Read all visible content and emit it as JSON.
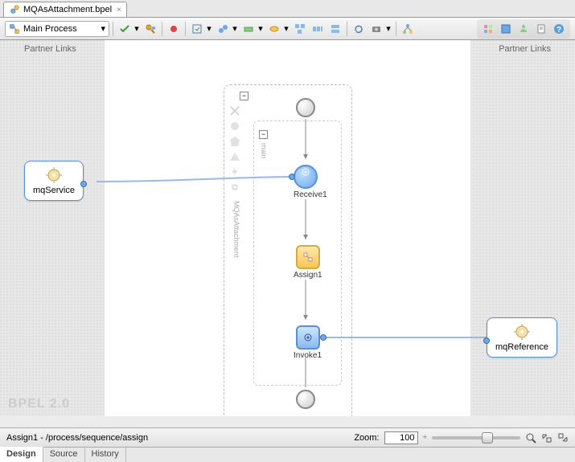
{
  "file": {
    "name": "MQAsAttachment.bpel"
  },
  "toolbar": {
    "scope_label": "Main Process"
  },
  "canvas": {
    "partner_links_label": "Partner Links",
    "bpel_version": "BPEL 2.0",
    "sequence_label": "MQAsAttachment",
    "scope_label": "main",
    "left_partner": {
      "name": "mqService"
    },
    "right_partner": {
      "name": "mqReference"
    },
    "nodes": {
      "receive": {
        "label": "Receive1"
      },
      "assign": {
        "label": "Assign1"
      },
      "invoke": {
        "label": "Invoke1"
      }
    }
  },
  "status": {
    "breadcrumb": "Assign1 - /process/sequence/assign",
    "zoom_label": "Zoom:",
    "zoom_value": "100",
    "zoom_suffix": "÷"
  },
  "tabs": {
    "design": "Design",
    "source": "Source",
    "history": "History"
  }
}
